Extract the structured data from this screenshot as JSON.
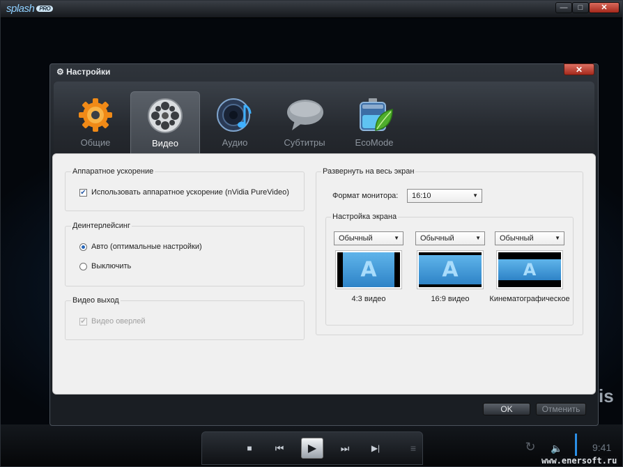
{
  "app": {
    "logo_text": "splash",
    "logo_badge": "PRO",
    "window_controls": {
      "minimize": "—",
      "maximize": "□",
      "close": "✕"
    },
    "player": {
      "time": "9:41",
      "side_text": "is",
      "watermark": "www.enersoft.ru",
      "buttons": {
        "settings": "⇌",
        "stop": "■",
        "prev": "⏮",
        "play": "▶",
        "next": "⏭",
        "step": "▶|",
        "playlist": "≡",
        "repeat": "↻",
        "volume": "🔈"
      }
    }
  },
  "dialog": {
    "title": "Настройки",
    "title_icon": "gear-icon",
    "close_label": "✕",
    "tabs": [
      {
        "label": "Общие",
        "icon": "gear-icon",
        "active": false
      },
      {
        "label": "Видео",
        "icon": "film-reel-icon",
        "active": true
      },
      {
        "label": "Аудио",
        "icon": "audio-note-icon",
        "active": false
      },
      {
        "label": "Субтитры",
        "icon": "speech-bubble-icon",
        "active": false
      },
      {
        "label": "EcoMode",
        "icon": "battery-leaf-icon",
        "active": false
      }
    ],
    "hardware": {
      "title": "Аппаратное ускорение",
      "checkbox_label": "Использовать аппаратное ускорение (nVidia PureVideo)",
      "checked": true
    },
    "deinterlace": {
      "title": "Деинтерлейсинг",
      "options": [
        {
          "label": "Авто (оптимальные настройки)",
          "selected": true
        },
        {
          "label": "Выключить",
          "selected": false
        }
      ]
    },
    "video_out": {
      "title": "Видео выход",
      "checkbox_label": "Видео оверлей",
      "checked": true,
      "disabled": true
    },
    "fullscreen": {
      "title": "Развернуть на весь экран",
      "monitor_label": "Формат монитора:",
      "monitor_value": "16:10",
      "screen_setup_title": "Настройка экрана",
      "presets": [
        {
          "value": "Обычный",
          "caption": "4:3 видео",
          "aspect": "4:3"
        },
        {
          "value": "Обычный",
          "caption": "16:9 видео",
          "aspect": "16:9"
        },
        {
          "value": "Обычный",
          "caption": "Кинематографическое",
          "aspect": "cinema"
        }
      ],
      "preview_letter": "A"
    },
    "ok_label": "OK",
    "cancel_label": "Отменить",
    "colors": {
      "accent": "#2e83c7",
      "close_red": "#a52a1c",
      "content_bg": "#f0f0f0"
    }
  }
}
